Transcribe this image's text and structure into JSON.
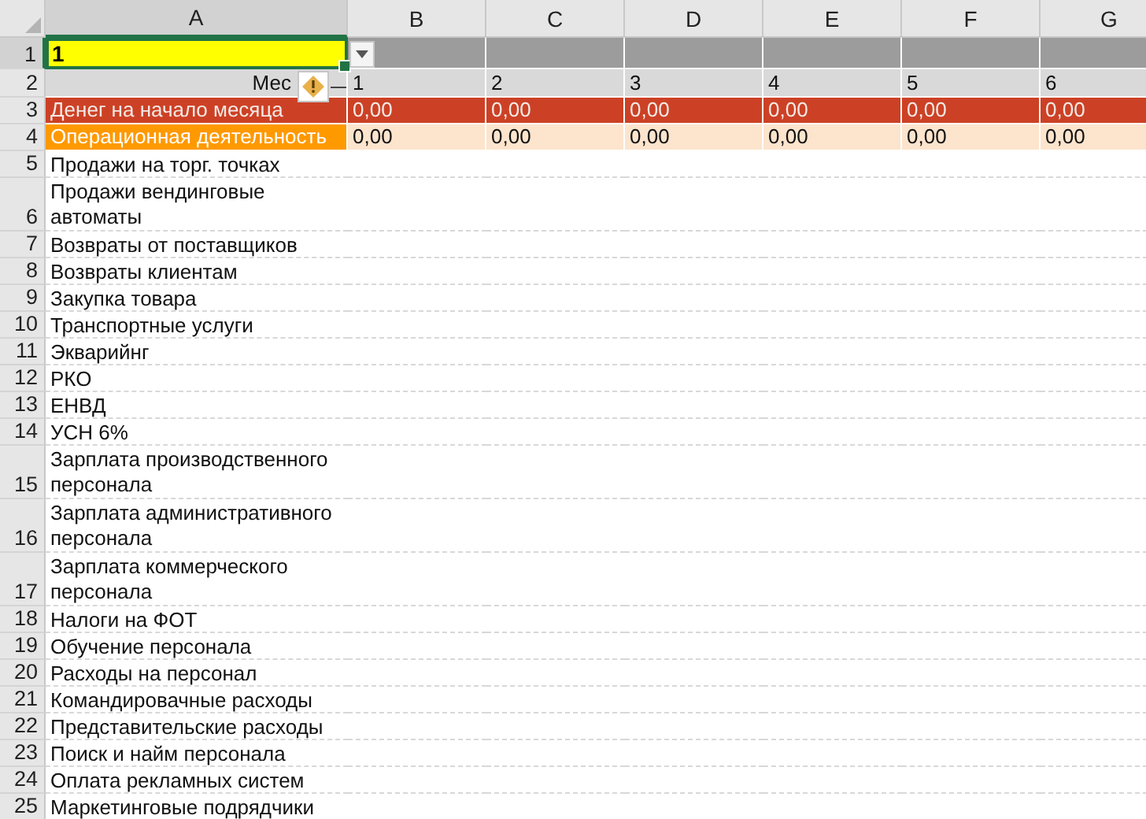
{
  "columns": [
    {
      "label": "A",
      "selected": true
    },
    {
      "label": "B",
      "selected": false
    },
    {
      "label": "C",
      "selected": false
    },
    {
      "label": "D",
      "selected": false
    },
    {
      "label": "E",
      "selected": false
    },
    {
      "label": "F",
      "selected": false
    },
    {
      "label": "G",
      "selected": false
    }
  ],
  "rows": [
    {
      "number": "1",
      "selected": true,
      "kind": "input",
      "cells": [
        "1",
        "",
        "",
        "",
        "",
        "",
        ""
      ]
    },
    {
      "number": "2",
      "selected": false,
      "kind": "header",
      "cells": [
        "Мес",
        "1",
        "2",
        "3",
        "4",
        "5",
        "6"
      ]
    },
    {
      "number": "3",
      "selected": false,
      "kind": "money",
      "cells": [
        "Денег на начало месяца",
        "0,00",
        "0,00",
        "0,00",
        "0,00",
        "0,00",
        "0,00"
      ]
    },
    {
      "number": "4",
      "selected": false,
      "kind": "section",
      "cells": [
        "Операционная деятельность",
        "0,00",
        "0,00",
        "0,00",
        "0,00",
        "0,00",
        "0,00"
      ]
    },
    {
      "number": "5",
      "selected": false,
      "kind": "item",
      "lines": [
        "Продажи на торг. точках"
      ]
    },
    {
      "number": "6",
      "selected": false,
      "kind": "item",
      "lines": [
        "Продажи вендинговые",
        "автоматы"
      ]
    },
    {
      "number": "7",
      "selected": false,
      "kind": "item",
      "lines": [
        "Возвраты от поставщиков"
      ]
    },
    {
      "number": "8",
      "selected": false,
      "kind": "item",
      "lines": [
        "Возвраты клиентам"
      ]
    },
    {
      "number": "9",
      "selected": false,
      "kind": "item",
      "lines": [
        "Закупка товара"
      ]
    },
    {
      "number": "10",
      "selected": false,
      "kind": "item",
      "lines": [
        "Транспортные услуги"
      ]
    },
    {
      "number": "11",
      "selected": false,
      "kind": "item",
      "lines": [
        "Экварийнг"
      ]
    },
    {
      "number": "12",
      "selected": false,
      "kind": "item",
      "lines": [
        "РКО"
      ]
    },
    {
      "number": "13",
      "selected": false,
      "kind": "item",
      "lines": [
        "ЕНВД"
      ]
    },
    {
      "number": "14",
      "selected": false,
      "kind": "item",
      "lines": [
        "УСН 6%"
      ]
    },
    {
      "number": "15",
      "selected": false,
      "kind": "item",
      "lines": [
        "Зарплата производственного",
        "персонала"
      ]
    },
    {
      "number": "16",
      "selected": false,
      "kind": "item",
      "lines": [
        "Зарплата административного",
        "персонала"
      ]
    },
    {
      "number": "17",
      "selected": false,
      "kind": "item",
      "lines": [
        "Зарплата коммерческого",
        "персонала"
      ]
    },
    {
      "number": "18",
      "selected": false,
      "kind": "item",
      "lines": [
        "Налоги на ФОТ"
      ]
    },
    {
      "number": "19",
      "selected": false,
      "kind": "item",
      "lines": [
        "Обучение персонала"
      ]
    },
    {
      "number": "20",
      "selected": false,
      "kind": "item",
      "lines": [
        "Расходы на персонал"
      ]
    },
    {
      "number": "21",
      "selected": false,
      "kind": "item",
      "lines": [
        "Командировачные расходы"
      ]
    },
    {
      "number": "22",
      "selected": false,
      "kind": "item",
      "lines": [
        "Представительские расходы"
      ]
    },
    {
      "number": "23",
      "selected": false,
      "kind": "item",
      "lines": [
        "Поиск и найм персонала"
      ]
    },
    {
      "number": "24",
      "selected": false,
      "kind": "item",
      "lines": [
        "Оплата рекламных систем"
      ]
    },
    {
      "number": "25",
      "selected": false,
      "kind": "item",
      "lines": [
        "Маркетинговые подрядчики"
      ]
    }
  ]
}
